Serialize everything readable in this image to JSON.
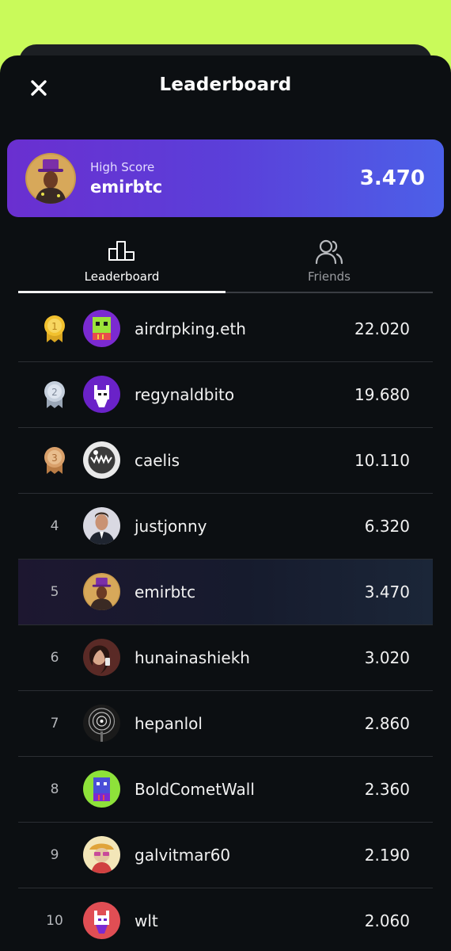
{
  "header": {
    "title": "Leaderboard",
    "close_icon": "close-icon"
  },
  "high_score": {
    "label": "High Score",
    "username": "emirbtc",
    "score": "3.470"
  },
  "tabs": [
    {
      "label": "Leaderboard",
      "icon": "podium-icon",
      "active": true
    },
    {
      "label": "Friends",
      "icon": "friends-icon",
      "active": false
    }
  ],
  "colors": {
    "background_accent": "#c9fa5a",
    "card_gradient_start": "#6a2fd0",
    "card_gradient_end": "#4c60e8",
    "gold": "#f2c12e",
    "silver": "#c5cfdc",
    "bronze": "#d9a06a"
  },
  "leaderboard": [
    {
      "rank": "1",
      "medal": "gold-medal-icon",
      "username": "airdrpking.eth",
      "score": "22.020"
    },
    {
      "rank": "2",
      "medal": "silver-medal-icon",
      "username": "regynaldbito",
      "score": "19.680"
    },
    {
      "rank": "3",
      "medal": "bronze-medal-icon",
      "username": "caelis",
      "score": "10.110"
    },
    {
      "rank": "4",
      "username": "justjonny",
      "score": "6.320"
    },
    {
      "rank": "5",
      "username": "emirbtc",
      "score": "3.470",
      "is_current_user": true
    },
    {
      "rank": "6",
      "username": "hunainashiekh",
      "score": "3.020"
    },
    {
      "rank": "7",
      "username": "hepanlol",
      "score": "2.860"
    },
    {
      "rank": "8",
      "username": "BoldCometWall",
      "score": "2.360"
    },
    {
      "rank": "9",
      "username": "galvitmar60",
      "score": "2.190"
    },
    {
      "rank": "10",
      "username": "wlt",
      "score": "2.060"
    }
  ]
}
